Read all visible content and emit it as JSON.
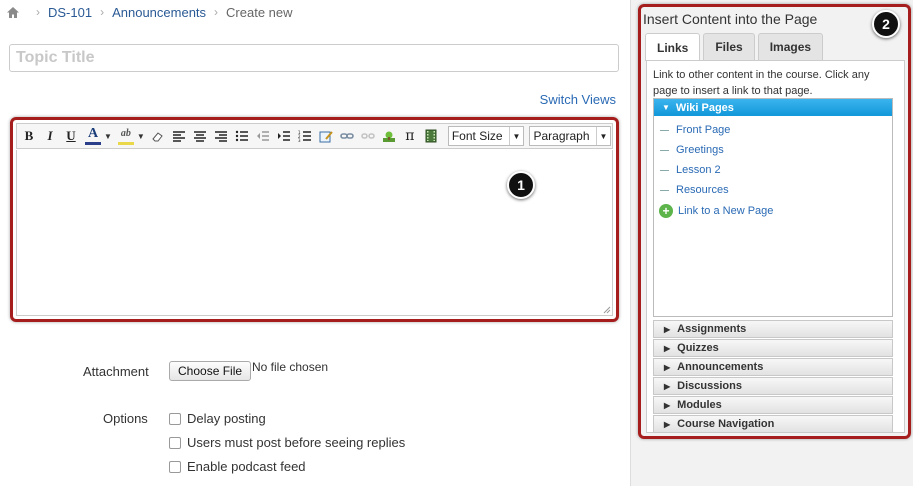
{
  "breadcrumb": {
    "items": [
      "DS-101",
      "Announcements",
      "Create new"
    ]
  },
  "topic": {
    "placeholder": "Topic Title"
  },
  "switch_views": "Switch Views",
  "toolbar": {
    "bold": "B",
    "italic": "I",
    "underline": "U",
    "text_color": "A",
    "highlight": "ab",
    "pi": "π",
    "font_size": "Font Size",
    "paragraph": "Paragraph"
  },
  "callouts": [
    "1",
    "2"
  ],
  "attachment": {
    "label": "Attachment",
    "button": "Choose File",
    "status": "No file chosen"
  },
  "options": {
    "label": "Options",
    "items": [
      "Delay posting",
      "Users must post before seeing replies",
      "Enable podcast feed"
    ]
  },
  "panel": {
    "title": "Insert Content into the Page",
    "tabs": [
      "Links",
      "Files",
      "Images"
    ],
    "help_text": "Link to other content in the course. Click any page to insert a link to that page.",
    "wiki_header": "Wiki Pages",
    "wiki_pages": [
      "Front Page",
      "Greetings",
      "Lesson 2",
      "Resources"
    ],
    "new_page": "Link to a New Page",
    "sections": [
      "Assignments",
      "Quizzes",
      "Announcements",
      "Discussions",
      "Modules",
      "Course Navigation"
    ]
  },
  "colors": {
    "annotation_border": "#a51d1d",
    "link": "#2a6ab5",
    "tree_header": "#1a9ee0"
  }
}
